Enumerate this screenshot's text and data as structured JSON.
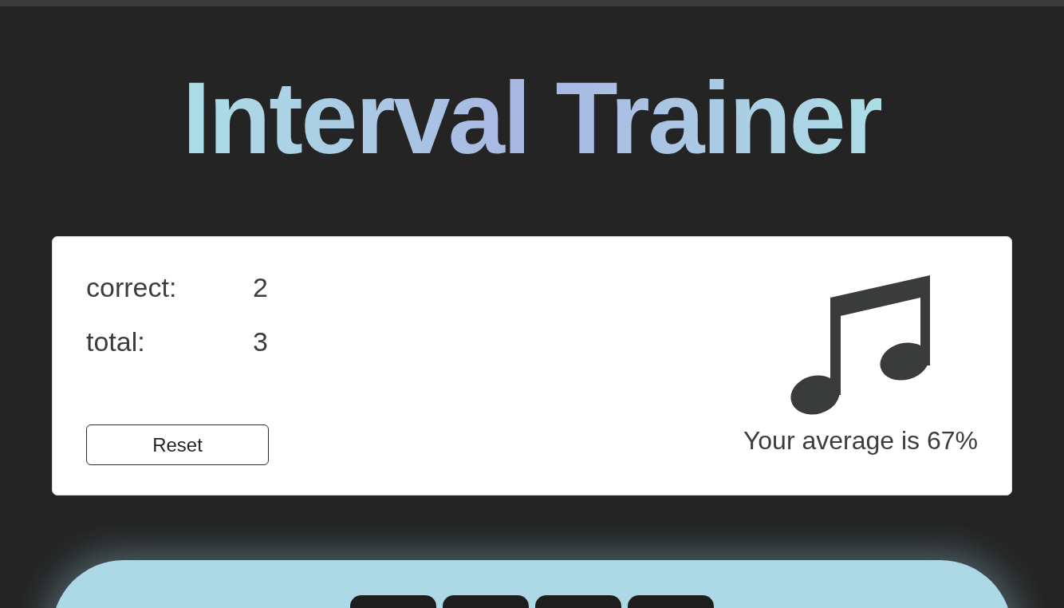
{
  "title": "Interval Trainer",
  "score_card": {
    "stats": [
      {
        "label": "correct:",
        "value": "2"
      },
      {
        "label": "total:",
        "value": "3"
      }
    ],
    "reset_button": "Reset",
    "average": "Your average is 67%"
  },
  "answer_panel": {
    "buttons": [
      {
        "kind": "button"
      },
      {
        "kind": "button"
      },
      {
        "kind": "button"
      },
      {
        "kind": "button"
      }
    ]
  }
}
